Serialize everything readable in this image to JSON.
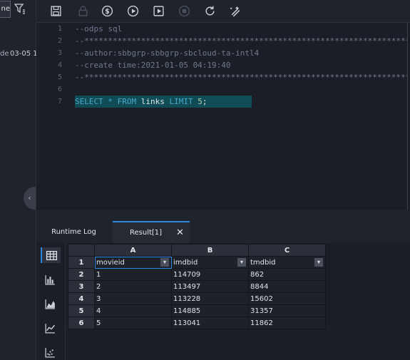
{
  "sidebar": {
    "name_box": "ne",
    "item_text": "de",
    "item_date": "03-05 1",
    "collapse_glyph": "‹"
  },
  "toolbar": {
    "icons": [
      "save-icon",
      "lock-icon",
      "dollar-icon",
      "run-icon",
      "run-advanced-icon",
      "stop-icon",
      "refresh-icon",
      "format-icon"
    ]
  },
  "editor": {
    "line_numbers": [
      "1",
      "2",
      "3",
      "4",
      "5",
      "6",
      "7"
    ],
    "lines": [
      "--odps sql",
      "--**********************************************************************",
      "--author:sbbgrp-sbbgrp-sbcloud-ta-intl4",
      "--create time:2021-01-05 04:19:40",
      "--**********************************************************************",
      "",
      ""
    ],
    "sql": {
      "kw_select": "SELECT",
      "star": " * ",
      "kw_from": "FROM",
      "table": " links ",
      "kw_limit": "LIMIT",
      "num": " 5",
      "semi": ";"
    }
  },
  "tabs": {
    "runtime_log": "Runtime Log",
    "result": "Result[1]",
    "close": "✕"
  },
  "grid": {
    "columns": [
      "A",
      "B",
      "C"
    ],
    "header_row": {
      "num": "1",
      "cells": [
        "movieid",
        "imdbid",
        "tmdbid"
      ]
    },
    "rows": [
      {
        "num": "2",
        "cells": [
          "1",
          "114709",
          "862"
        ]
      },
      {
        "num": "3",
        "cells": [
          "2",
          "113497",
          "8844"
        ]
      },
      {
        "num": "4",
        "cells": [
          "3",
          "113228",
          "15602"
        ]
      },
      {
        "num": "5",
        "cells": [
          "4",
          "114885",
          "31357"
        ]
      },
      {
        "num": "6",
        "cells": [
          "5",
          "113041",
          "11862"
        ]
      }
    ],
    "dropdown_glyph": "▾"
  },
  "colors": {
    "accent": "#2e86de",
    "highlight": "#0f4c55",
    "keyword": "#4aa8c9",
    "comment": "#6f7a8f"
  }
}
